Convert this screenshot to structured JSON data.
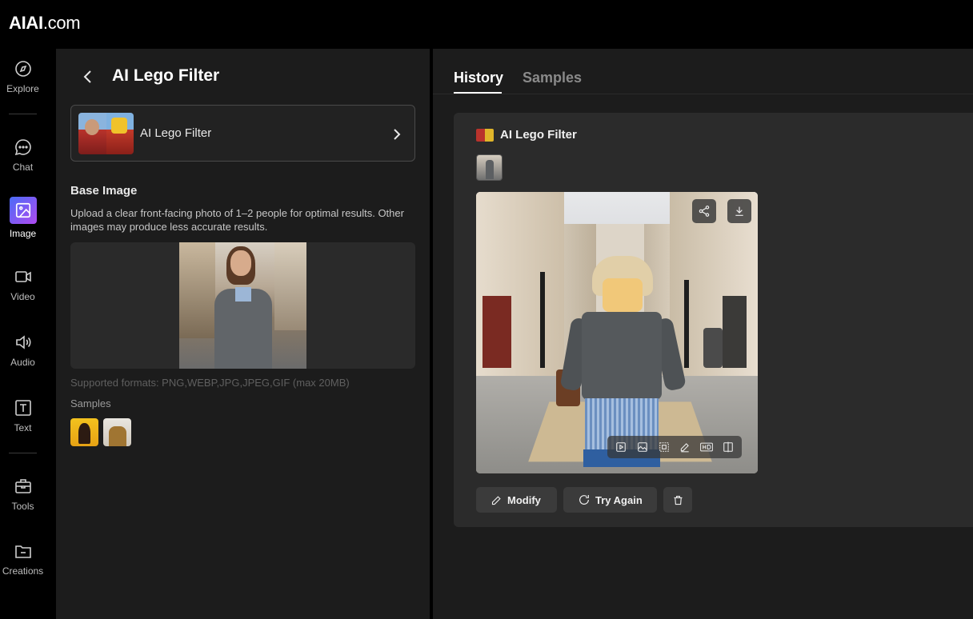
{
  "app": {
    "logo_brand": "AIAI",
    "logo_domain": ".com"
  },
  "sidebar": {
    "items": [
      {
        "label": "Explore",
        "icon": "compass-icon"
      },
      {
        "label": "Chat",
        "icon": "chat-bubble-icon"
      },
      {
        "label": "Image",
        "icon": "image-icon",
        "active": true
      },
      {
        "label": "Video",
        "icon": "video-camera-icon"
      },
      {
        "label": "Audio",
        "icon": "speaker-icon"
      },
      {
        "label": "Text",
        "icon": "text-box-icon"
      },
      {
        "label": "Tools",
        "icon": "toolbox-icon"
      },
      {
        "label": "Creations",
        "icon": "folder-icon"
      }
    ],
    "active_color": "#7a5cf5"
  },
  "left_panel": {
    "title": "AI Lego Filter",
    "filter_card": {
      "name": "AI Lego Filter"
    },
    "base_image": {
      "heading": "Base Image",
      "description": "Upload a clear front-facing photo of 1–2 people for optimal results. Other images may produce less accurate results.",
      "formats": "Supported formats: PNG,WEBP,JPG,JPEG,GIF (max 20MB)"
    },
    "samples": {
      "heading": "Samples"
    }
  },
  "right_panel": {
    "tabs": [
      {
        "label": "History",
        "active": true
      },
      {
        "label": "Samples",
        "active": false
      }
    ],
    "result": {
      "title": "AI Lego Filter",
      "actions": {
        "modify": "Modify",
        "try_again": "Try Again"
      }
    }
  }
}
